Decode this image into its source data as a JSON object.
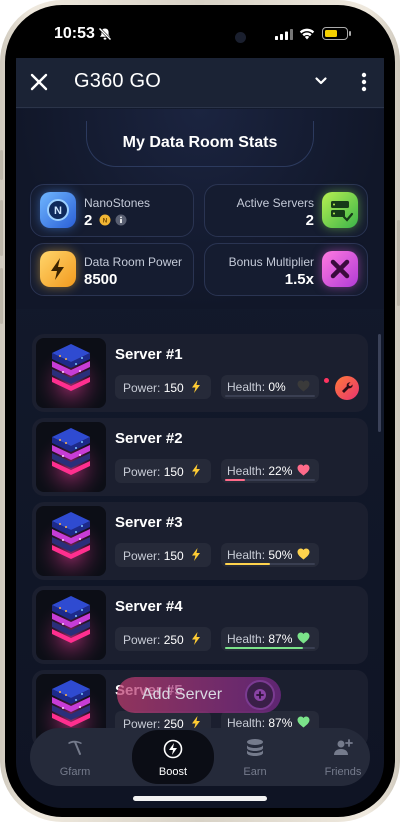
{
  "status_bar": {
    "time": "10:53"
  },
  "header": {
    "title": "G360 GO"
  },
  "stats": {
    "title": "My Data Room Stats",
    "nanostones": {
      "label": "NanoStones",
      "value": "2"
    },
    "active_servers": {
      "label": "Active Servers",
      "value": "2"
    },
    "data_room_power": {
      "label": "Data Room Power",
      "value": "8500"
    },
    "bonus_multiplier": {
      "label": "Bonus Multiplier",
      "value": "1.5x"
    }
  },
  "servers": [
    {
      "name": "Server #1",
      "power_label": "Power:",
      "power": "150",
      "health_label": "Health:",
      "health": "0%",
      "health_fraction": 0.0,
      "heart_color": "#3a3a3a"
    },
    {
      "name": "Server #2",
      "power_label": "Power:",
      "power": "150",
      "health_label": "Health:",
      "health": "22%",
      "health_fraction": 0.22,
      "heart_color": "#ff6b8a"
    },
    {
      "name": "Server #3",
      "power_label": "Power:",
      "power": "150",
      "health_label": "Health:",
      "health": "50%",
      "health_fraction": 0.5,
      "heart_color": "#ffd34d"
    },
    {
      "name": "Server #4",
      "power_label": "Power:",
      "power": "250",
      "health_label": "Health:",
      "health": "87%",
      "health_fraction": 0.87,
      "heart_color": "#7be38a"
    },
    {
      "name": "Server #5",
      "power_label": "Power:",
      "power": "250",
      "health_label": "Health:",
      "health": "87%",
      "health_fraction": 0.87,
      "heart_color": "#7be38a"
    }
  ],
  "add_server": {
    "label": "Add Server"
  },
  "nav": [
    {
      "label": "Gfarm",
      "icon": "pickaxe-icon"
    },
    {
      "label": "Boost",
      "icon": "boost-bolt-icon"
    },
    {
      "label": "Earn",
      "icon": "coins-icon"
    },
    {
      "label": "Friends",
      "icon": "friends-icon"
    }
  ],
  "colors": {
    "accent_pink": "#e8336f",
    "health_low": "#ff6b8a",
    "health_mid": "#ffd34d",
    "health_high": "#7be38a"
  }
}
